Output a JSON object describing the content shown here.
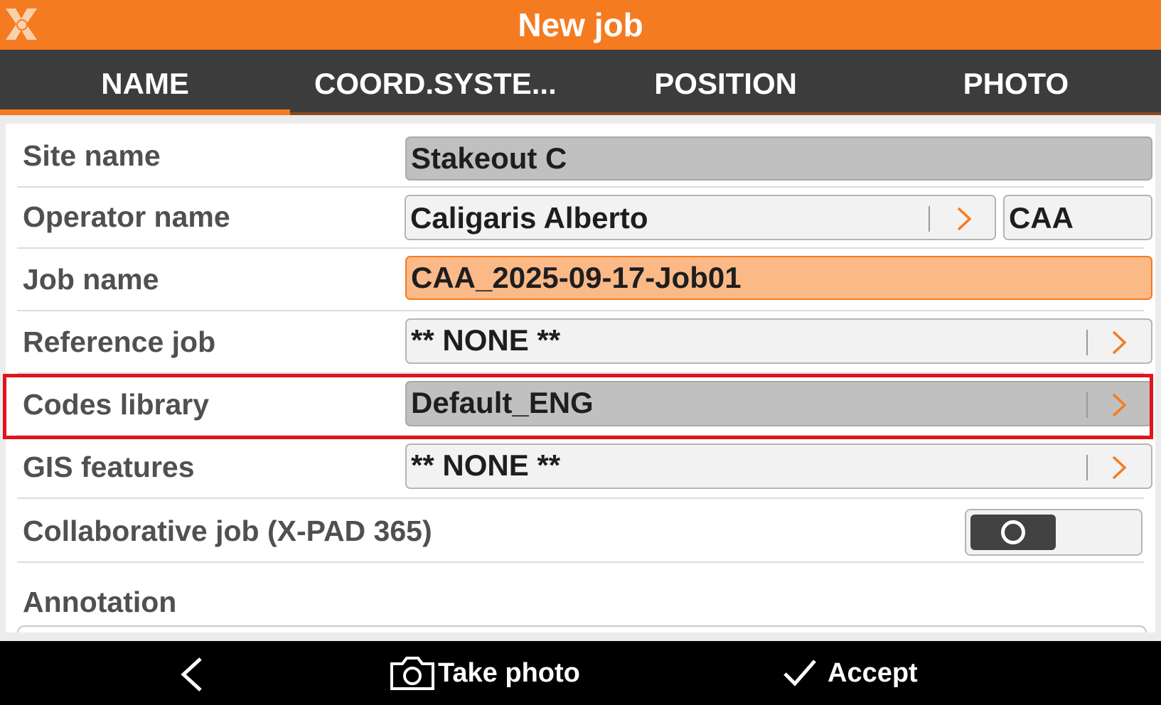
{
  "header": {
    "title": "New job",
    "logo_icon": "x-pad-logo-icon",
    "accent_color": "#f47b20"
  },
  "tabs": [
    {
      "label": "NAME",
      "active": true
    },
    {
      "label": "COORD.SYSTE...",
      "active": false
    },
    {
      "label": "POSITION",
      "active": false
    },
    {
      "label": "PHOTO",
      "active": false
    }
  ],
  "form": {
    "site_name": {
      "label": "Site name",
      "value": "Stakeout C"
    },
    "operator_name": {
      "label": "Operator name",
      "value": "Caligaris Alberto",
      "initials": "CAA"
    },
    "job_name": {
      "label": "Job name",
      "value": "CAA_2025-09-17-Job01"
    },
    "reference_job": {
      "label": "Reference job",
      "value": "** NONE **"
    },
    "codes_library": {
      "label": "Codes library",
      "value": "Default_ENG",
      "highlighted": true
    },
    "gis_features": {
      "label": "GIS features",
      "value": "** NONE **"
    },
    "collaborative_job": {
      "label": "Collaborative job (X-PAD 365)",
      "enabled": false
    },
    "annotation": {
      "label": "Annotation",
      "value": ""
    }
  },
  "bottom_bar": {
    "back_icon": "chevron-left-icon",
    "take_photo": {
      "label": "Take photo",
      "icon": "camera-icon"
    },
    "accept": {
      "label": "Accept",
      "icon": "checkmark-icon"
    }
  }
}
